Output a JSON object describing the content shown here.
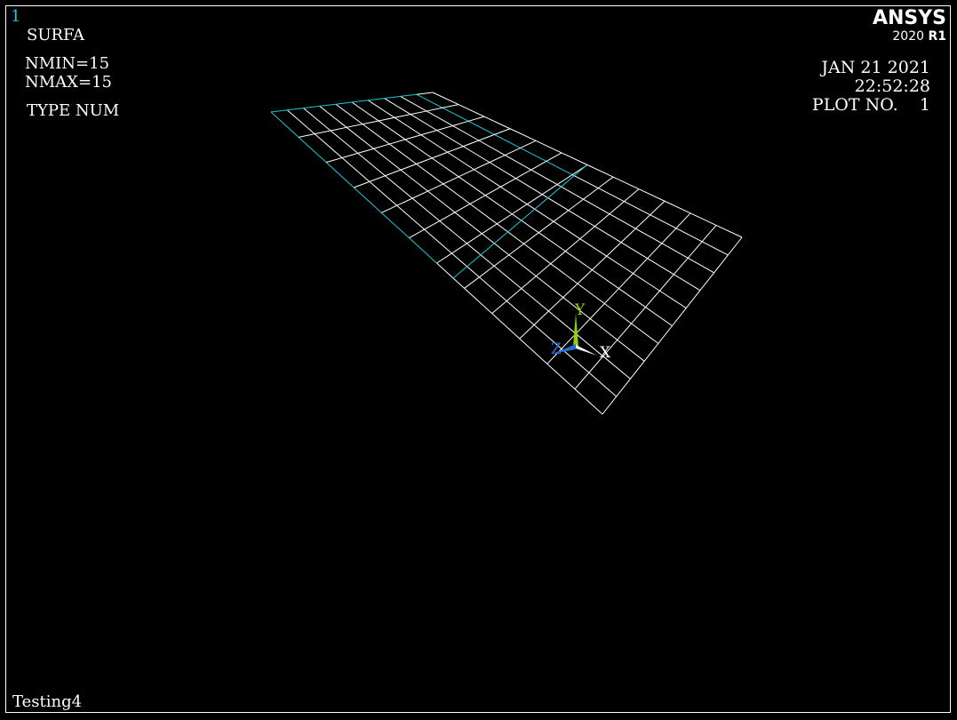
{
  "viewport": {
    "window_number": "1",
    "plot_type": "SURFA",
    "nmin": "NMIN=15",
    "nmax": "NMAX=15",
    "type_num": "TYPE NUM",
    "date": "JAN 21 2021",
    "time": "22:52:28",
    "plot_no_label": "PLOT NO.",
    "plot_no_value": "1",
    "title": "Testing4"
  },
  "brand": {
    "name": "ANSYS",
    "version": "2020",
    "release": "R1"
  },
  "triad": {
    "x_label": "X",
    "y_label": "Y",
    "z_label": "Z"
  },
  "colors": {
    "background": "#000000",
    "mesh": "#ffffff",
    "highlight": "#19c8d8",
    "y_axis": "#8fd400",
    "z_axis": "#1e6fd0"
  }
}
